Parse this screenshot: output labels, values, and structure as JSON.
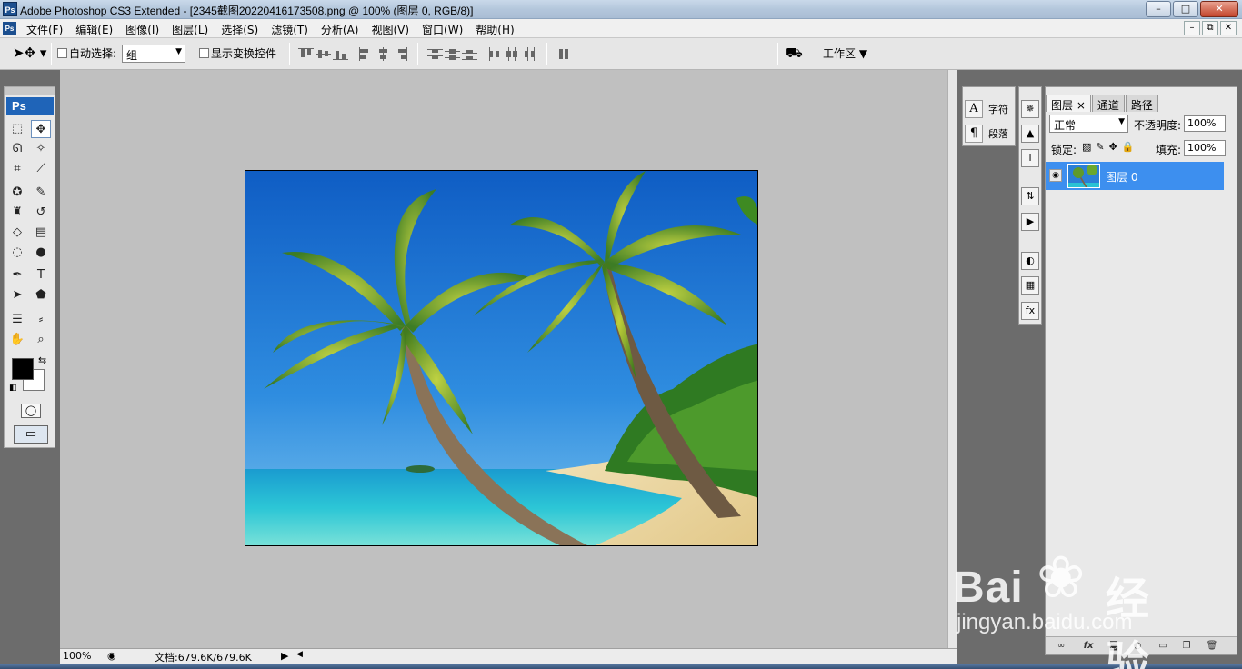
{
  "titlebar": {
    "title": "Adobe Photoshop CS3 Extended - [2345截图20220416173508.png @ 100% (图层 0, RGB/8)]",
    "logo": "Ps",
    "minimize": "–",
    "maximize": "□",
    "close": "✕"
  },
  "menubar": {
    "logo": "Ps",
    "items": [
      "文件(F)",
      "编辑(E)",
      "图像(I)",
      "图层(L)",
      "选择(S)",
      "滤镜(T)",
      "分析(A)",
      "视图(V)",
      "窗口(W)",
      "帮助(H)"
    ],
    "doc_min": "–",
    "doc_restore": "⧉",
    "doc_close": "✕"
  },
  "options": {
    "auto_select_label": "自动选择:",
    "auto_select_value": "组",
    "show_transform_label": "显示变换控件",
    "workspace_label": "工作区"
  },
  "toolbox": {
    "logo": "Ps",
    "tools": [
      {
        "name": "marquee-tool",
        "glyph": "⬚"
      },
      {
        "name": "move-tool",
        "glyph": "✥"
      },
      {
        "name": "lasso-tool",
        "glyph": "ᘏ"
      },
      {
        "name": "magic-wand-tool",
        "glyph": "✧"
      },
      {
        "name": "crop-tool",
        "glyph": "⌗"
      },
      {
        "name": "slice-tool",
        "glyph": "⟋"
      },
      {
        "name": "healing-brush-tool",
        "glyph": "✪"
      },
      {
        "name": "brush-tool",
        "glyph": "✎"
      },
      {
        "name": "clone-stamp-tool",
        "glyph": "♜"
      },
      {
        "name": "history-brush-tool",
        "glyph": "↺"
      },
      {
        "name": "eraser-tool",
        "glyph": "◇"
      },
      {
        "name": "gradient-tool",
        "glyph": "▤"
      },
      {
        "name": "blur-tool",
        "glyph": "◌"
      },
      {
        "name": "dodge-tool",
        "glyph": "●"
      },
      {
        "name": "pen-tool",
        "glyph": "✒"
      },
      {
        "name": "type-tool",
        "glyph": "T"
      },
      {
        "name": "path-selection-tool",
        "glyph": "➤"
      },
      {
        "name": "shape-tool",
        "glyph": "⬟"
      },
      {
        "name": "notes-tool",
        "glyph": "☰"
      },
      {
        "name": "eyedropper-tool",
        "glyph": "⸗"
      },
      {
        "name": "hand-tool",
        "glyph": "✋"
      },
      {
        "name": "zoom-tool",
        "glyph": "⌕"
      }
    ]
  },
  "statusbar": {
    "zoom": "100%",
    "docinfo": "文档:679.6K/679.6K"
  },
  "char_panel": {
    "char_glyph": "A",
    "char_label": "字符",
    "para_glyph": "¶",
    "para_label": "段落"
  },
  "icon_strip": [
    "✵",
    "▲",
    "i",
    "⇅",
    "▶",
    "◐",
    "▦",
    "fx"
  ],
  "layers_panel": {
    "tabs": [
      "图层",
      "通道",
      "路径"
    ],
    "tab_close": "×",
    "blend_mode": "正常",
    "opacity_label": "不透明度:",
    "opacity_value": "100%",
    "lock_label": "锁定:",
    "fill_label": "填充:",
    "fill_value": "100%",
    "layers": [
      {
        "name": "图层 0",
        "visible": true,
        "selected": true
      }
    ],
    "bottom_icons": [
      "link",
      "fx",
      "mask",
      "adjustment",
      "group",
      "new",
      "trash"
    ]
  },
  "watermark": {
    "brand_a": "Bai",
    "brand_b": "经验",
    "url": "jingyan.baidu.com"
  },
  "colors": {
    "canvas_bg": "#c0c0c0",
    "panel_bg": "#6c6c6c",
    "selected_layer": "#3d8fef",
    "foreground": "#000000",
    "background": "#ffffff"
  }
}
